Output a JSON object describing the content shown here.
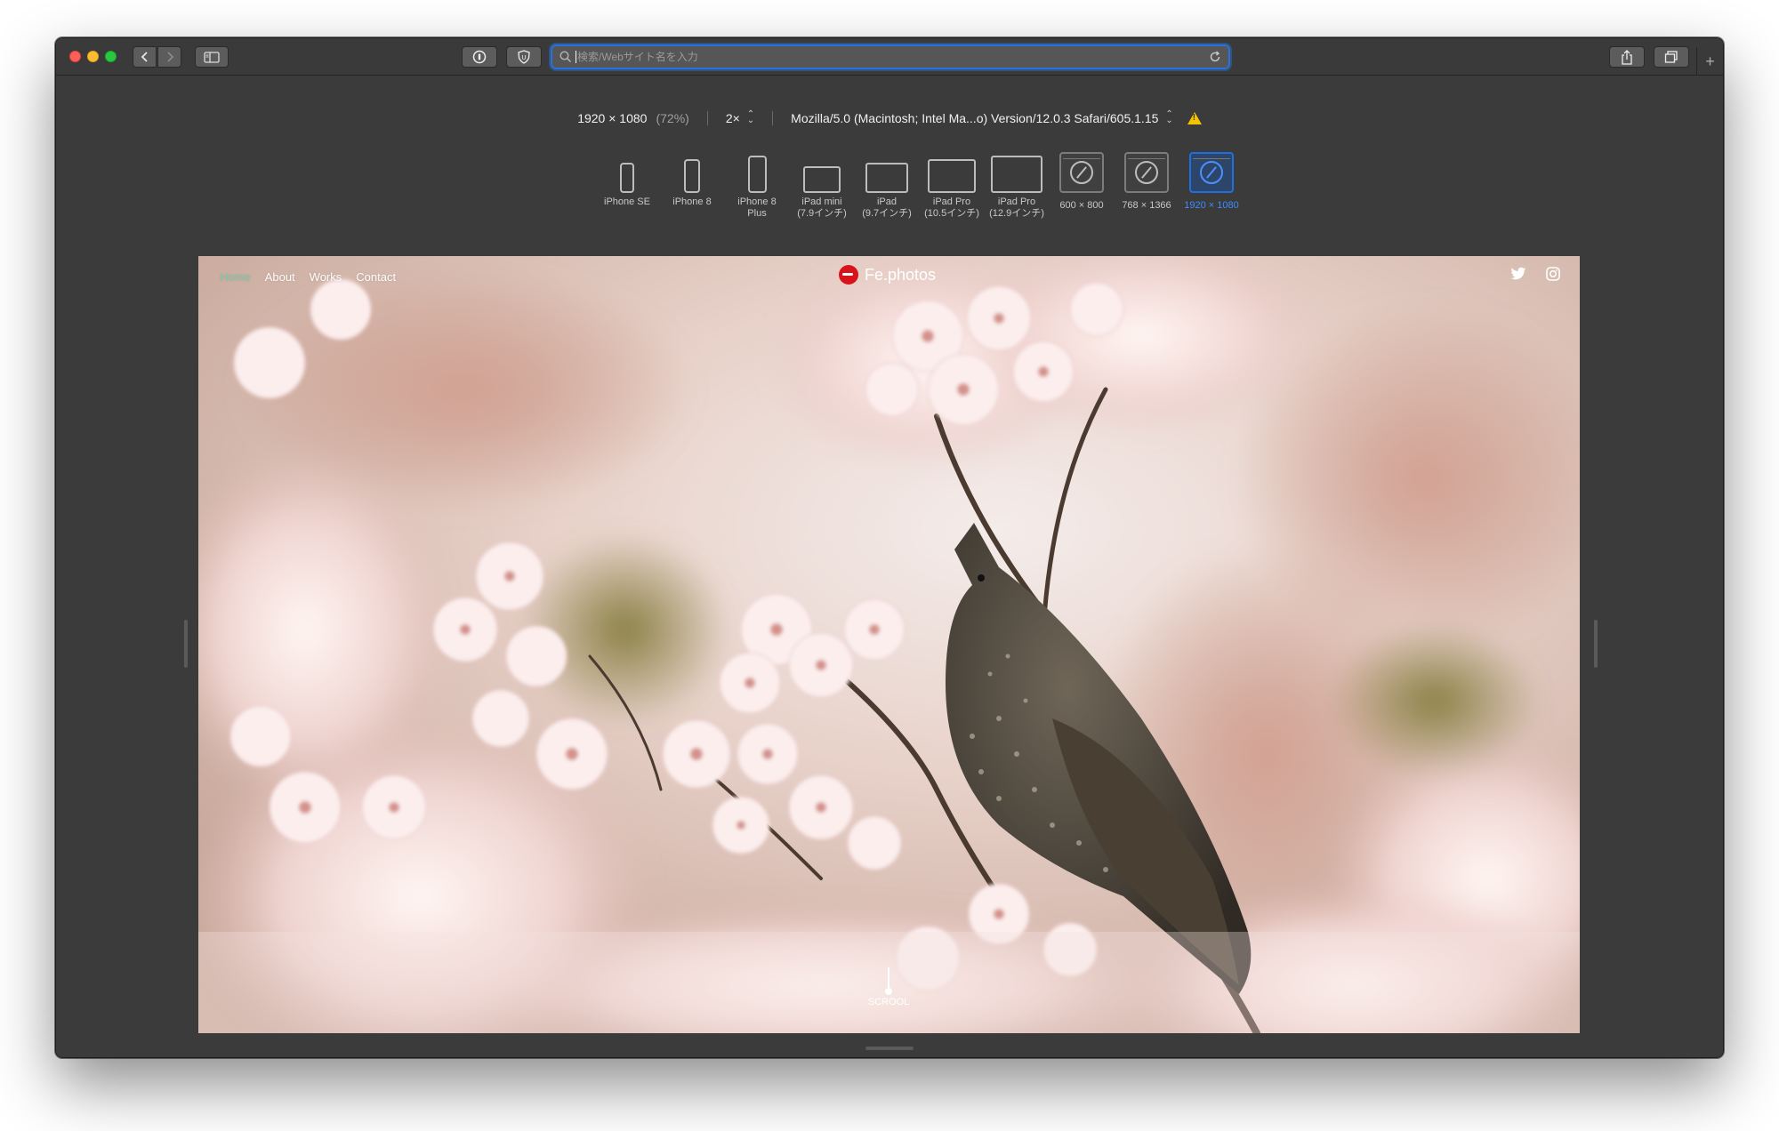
{
  "browser": {
    "url_placeholder": "検索/Webサイト名を入力",
    "new_tab_symbol": "+"
  },
  "responsive": {
    "resolution": "1920 × 1080",
    "zoom": "(72%)",
    "pixel_ratio": "2×",
    "user_agent": "Mozilla/5.0 (Macintosh; Intel Ma...o) Version/12.0.3 Safari/605.1.15",
    "devices": [
      {
        "label_1": "iPhone SE",
        "label_2": ""
      },
      {
        "label_1": "iPhone 8",
        "label_2": ""
      },
      {
        "label_1": "iPhone 8",
        "label_2": "Plus"
      },
      {
        "label_1": "iPad mini",
        "label_2": "(7.9インチ)"
      },
      {
        "label_1": "iPad",
        "label_2": "(9.7インチ)"
      },
      {
        "label_1": "iPad Pro",
        "label_2": "(10.5インチ)"
      },
      {
        "label_1": "iPad Pro",
        "label_2": "(12.9インチ)"
      },
      {
        "label_1": "600 × 800",
        "label_2": ""
      },
      {
        "label_1": "768 × 1366",
        "label_2": ""
      },
      {
        "label_1": "1920 × 1080",
        "label_2": ""
      }
    ],
    "selected_device": "1920 × 1080"
  },
  "site": {
    "nav": [
      "Home",
      "About",
      "Works",
      "Contact"
    ],
    "active_nav": "Home",
    "logo_text": "Fe.photos",
    "scroll_label": "SCROOL"
  },
  "colors": {
    "accent": "#2b71d6",
    "nav_active": "#7ac9a7",
    "logo_red": "#d8141a"
  }
}
